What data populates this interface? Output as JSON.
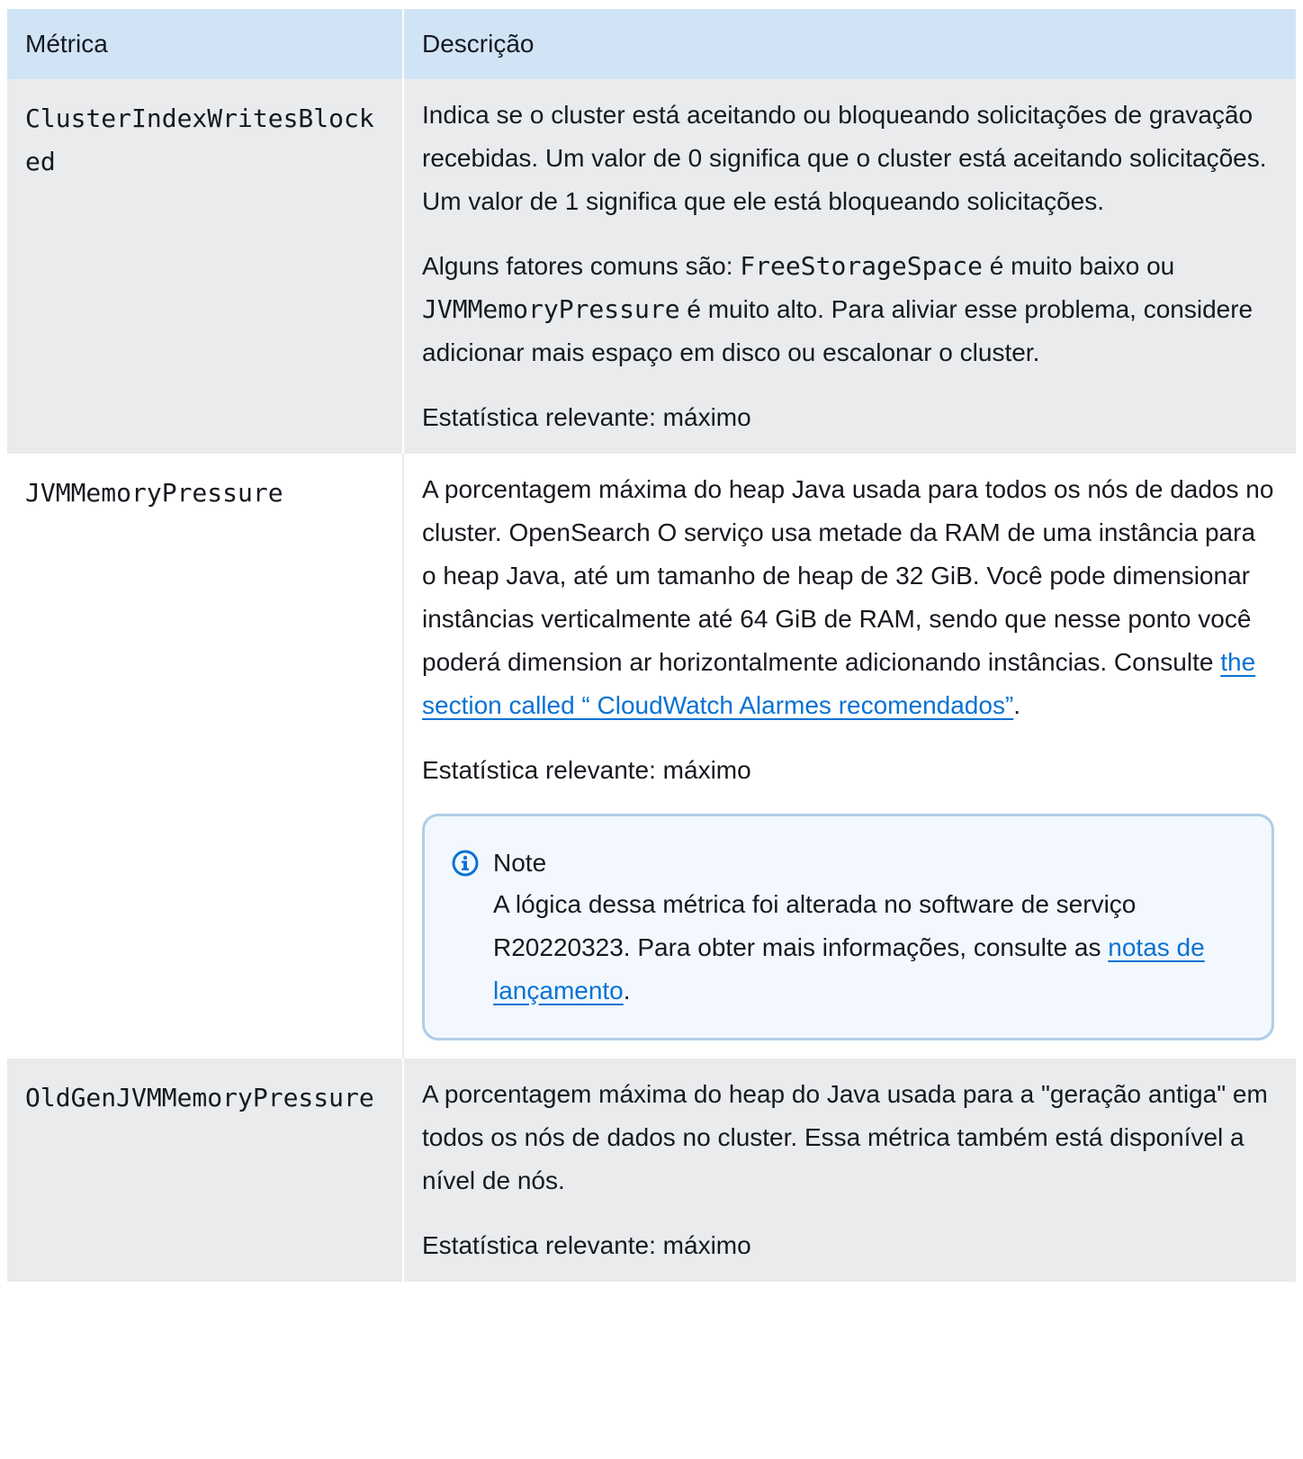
{
  "table": {
    "headers": {
      "metric": "Métrica",
      "description": "Descrição"
    },
    "rows": [
      {
        "metric": "ClusterIndexWritesBlocked",
        "desc_p1": "Indica se o cluster está aceitando ou bloqueando solicitações de gravação recebidas. Um valor de 0 significa que o cluster está aceitando solicitações. Um valor de 1 significa que ele está bloqueando solicitações.",
        "desc_p2_a": "Alguns fatores comuns são: ",
        "desc_p2_code1": "FreeStorageSpace",
        "desc_p2_b": " é muito baixo ou ",
        "desc_p2_code2": "JVMMemoryPressure",
        "desc_p2_c": " é muito alto. Para aliviar esse problema, considere adicionar mais espaço em disco ou escalonar o cluster.",
        "stat": "Estatística relevante: máximo"
      },
      {
        "metric": "JVMMemoryPressure",
        "desc_p1": "A porcentagem máxima do heap Java usada para todos os nós de dados no cluster. OpenSearch O serviço usa metade da RAM de uma instância para o heap Java, até um tamanho de heap de 32 GiB. Você pode dimensionar instâncias verticalmente até 64 GiB de RAM, sendo que nesse ponto você poderá dimension ar horizontalmente adicionando instâncias. Consulte ",
        "desc_p1_link": "the section called “ CloudWatch Alarmes recomendados”",
        "desc_p1_end": ".",
        "stat": "Estatística relevante: máximo",
        "note": {
          "icon": "info-icon",
          "title": "Note",
          "text": "A lógica dessa métrica foi alterada no software de serviço R20220323. Para obter mais informações, consulte as ",
          "link": "notas de lançamento",
          "end": "."
        }
      },
      {
        "metric": "OldGenJVMMemoryPressure",
        "desc_p1": "A porcentagem máxima do heap do Java usada para a \"geração antiga\" em todos os nós de dados no cluster. Essa métrica também está disponível a nível de nós.",
        "stat": "Estatística relevante: máximo"
      }
    ]
  },
  "colors": {
    "header_bg": "#d1e4f6",
    "row_alt_bg": "#e9ebed",
    "link": "#0972d3",
    "note_border": "#b0cde8",
    "note_bg": "#f2f8fd"
  }
}
